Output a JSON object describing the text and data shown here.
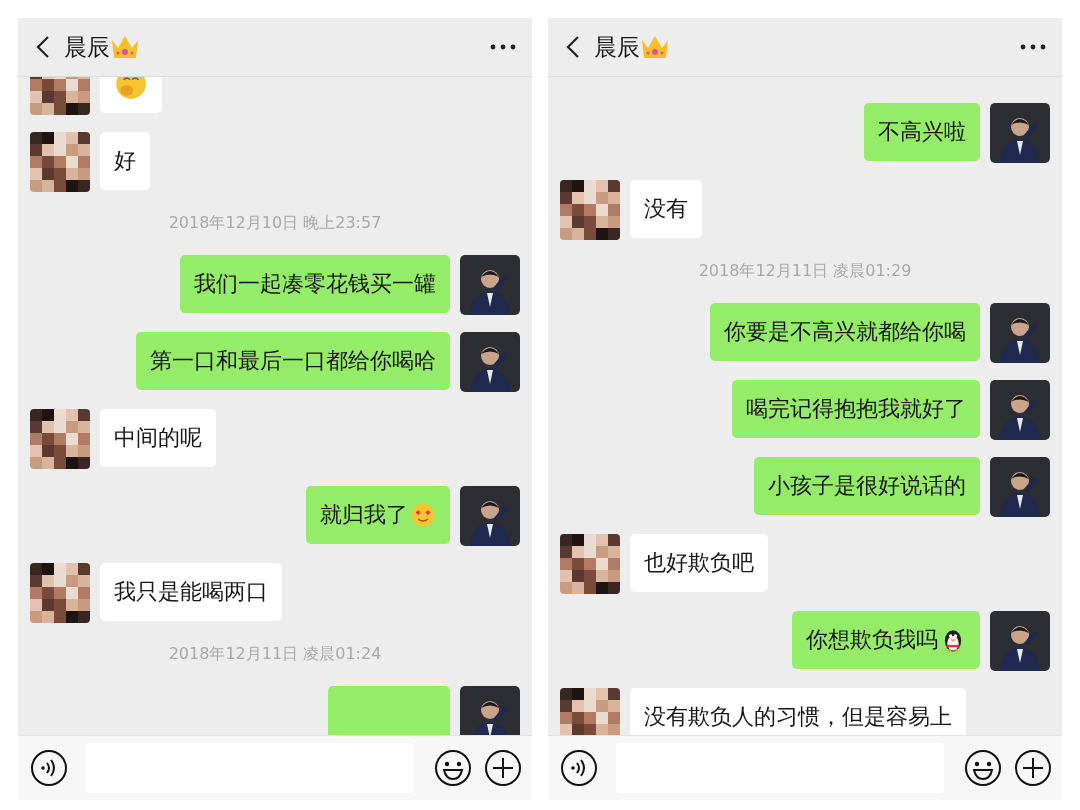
{
  "panels": [
    {
      "header": {
        "title": "晨辰"
      },
      "messages": [
        {
          "kind": "in",
          "emoji": {
            "kind": "giggle"
          }
        },
        {
          "kind": "in",
          "text": "好"
        },
        {
          "kind": "time",
          "text": "2018年12月10日 晚上23:57"
        },
        {
          "kind": "out",
          "text": "我们一起凑零花钱买一罐"
        },
        {
          "kind": "out",
          "text": "第一口和最后一口都给你喝哈"
        },
        {
          "kind": "in",
          "text": "中间的呢"
        },
        {
          "kind": "out",
          "text": "就归我了",
          "emoji": {
            "kind": "heart-eyes"
          }
        },
        {
          "kind": "in",
          "text": "我只是能喝两口"
        },
        {
          "kind": "time",
          "text": "2018年12月11日 凌晨01:24"
        },
        {
          "kind": "out"
        }
      ]
    },
    {
      "header": {
        "title": "晨辰"
      },
      "messages": [
        {
          "kind": "out",
          "text": "不高兴啦"
        },
        {
          "kind": "in",
          "text": "没有"
        },
        {
          "kind": "time",
          "text": "2018年12月11日 凌晨01:29"
        },
        {
          "kind": "out",
          "text": "你要是不高兴就都给你喝"
        },
        {
          "kind": "out",
          "text": "喝完记得抱抱我就好了"
        },
        {
          "kind": "out",
          "text": "小孩子是很好说话的"
        },
        {
          "kind": "in",
          "text": "也好欺负吧"
        },
        {
          "kind": "out",
          "text": "你想欺负我吗",
          "emoji": {
            "kind": "penguin"
          }
        },
        {
          "kind": "in",
          "text": "没有欺负人的习惯，但是容易上"
        }
      ]
    }
  ]
}
